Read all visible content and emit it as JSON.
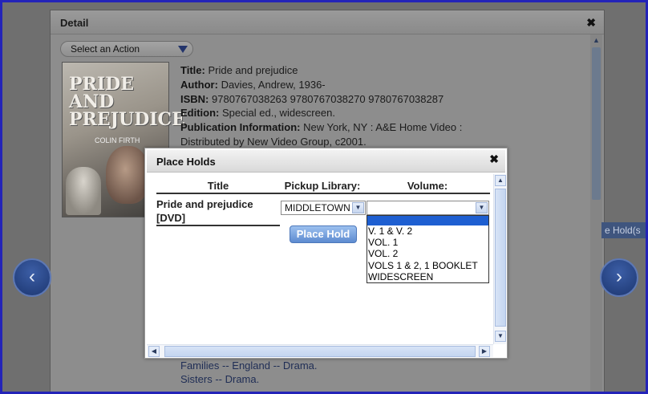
{
  "detail": {
    "title": "Detail",
    "close": "✖",
    "action_select": "Select an Action",
    "cover": {
      "title": "PRIDE AND PREJUDICE",
      "name": "COLIN FIRTH"
    },
    "fields": [
      {
        "label": "Title:",
        "value": "Pride and prejudice"
      },
      {
        "label": "Author:",
        "value": "Davies, Andrew, 1936-"
      },
      {
        "label": "ISBN:",
        "value": "9780767038263 9780767038270 9780767038287"
      },
      {
        "label": "Edition:",
        "value": "Special ed., widescreen."
      },
      {
        "label": "Publication Information:",
        "value": "New York, NY : A&E Home Video :"
      },
      {
        "label": "",
        "value": "Distributed by New Video Group, c2001."
      }
    ],
    "subjects": [
      "Families -- England -- Drama.",
      "Sisters -- Drama."
    ],
    "side_tag": "e Hold(s"
  },
  "nav": {
    "prev_icon": "‹",
    "next_icon": "›"
  },
  "modal": {
    "title": "Place Holds",
    "close": "✖",
    "headers": [
      "Title",
      "Pickup Library:",
      "Volume:"
    ],
    "row_title": "Pride and prejudice [DVD]",
    "pickup_value": "MIDDLETOWN",
    "volume_value": "",
    "volume_options": [
      "",
      "V. 1 & V. 2",
      "VOL. 1",
      "VOL. 2",
      "VOLS 1 & 2, 1 BOOKLET",
      "WIDESCREEN"
    ],
    "place_hold_label": "Place Hold"
  }
}
